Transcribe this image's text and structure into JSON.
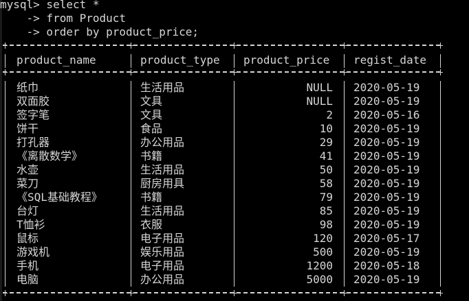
{
  "console": {
    "line1": "mysql> select *",
    "line2": "    -> from Product",
    "line3": "    -> order by product_price;"
  },
  "table": {
    "columns": [
      "product_name",
      "product_type",
      "product_price",
      "regist_date"
    ],
    "rows": [
      [
        "纸巾",
        "生活用品",
        "NULL",
        "2020-05-19"
      ],
      [
        "双面胶",
        "文具",
        "NULL",
        "2020-05-19"
      ],
      [
        "签字笔",
        "文具",
        "2",
        "2020-05-16"
      ],
      [
        "饼干",
        "食品",
        "10",
        "2020-05-19"
      ],
      [
        "打孔器",
        "办公用品",
        "29",
        "2020-05-19"
      ],
      [
        "《离散数学》",
        "书籍",
        "41",
        "2020-05-19"
      ],
      [
        "水壶",
        "生活用品",
        "50",
        "2020-05-19"
      ],
      [
        "菜刀",
        "厨房用具",
        "58",
        "2020-05-19"
      ],
      [
        "《SQL基础教程》",
        "书籍",
        "79",
        "2020-05-19"
      ],
      [
        "台灯",
        "生活用品",
        "85",
        "2020-05-19"
      ],
      [
        "T恤衫",
        "衣服",
        "98",
        "2020-05-19"
      ],
      [
        "鼠标",
        "电子用品",
        "120",
        "2020-05-17"
      ],
      [
        "游戏机",
        "娱乐用品",
        "500",
        "2020-05-19"
      ],
      [
        "手机",
        "电子用品",
        "1200",
        "2020-05-18"
      ],
      [
        "电脑",
        "办公用品",
        "5000",
        "2020-05-19"
      ]
    ]
  },
  "colors": {
    "background": "#000000",
    "text": "#d6d6d6"
  }
}
